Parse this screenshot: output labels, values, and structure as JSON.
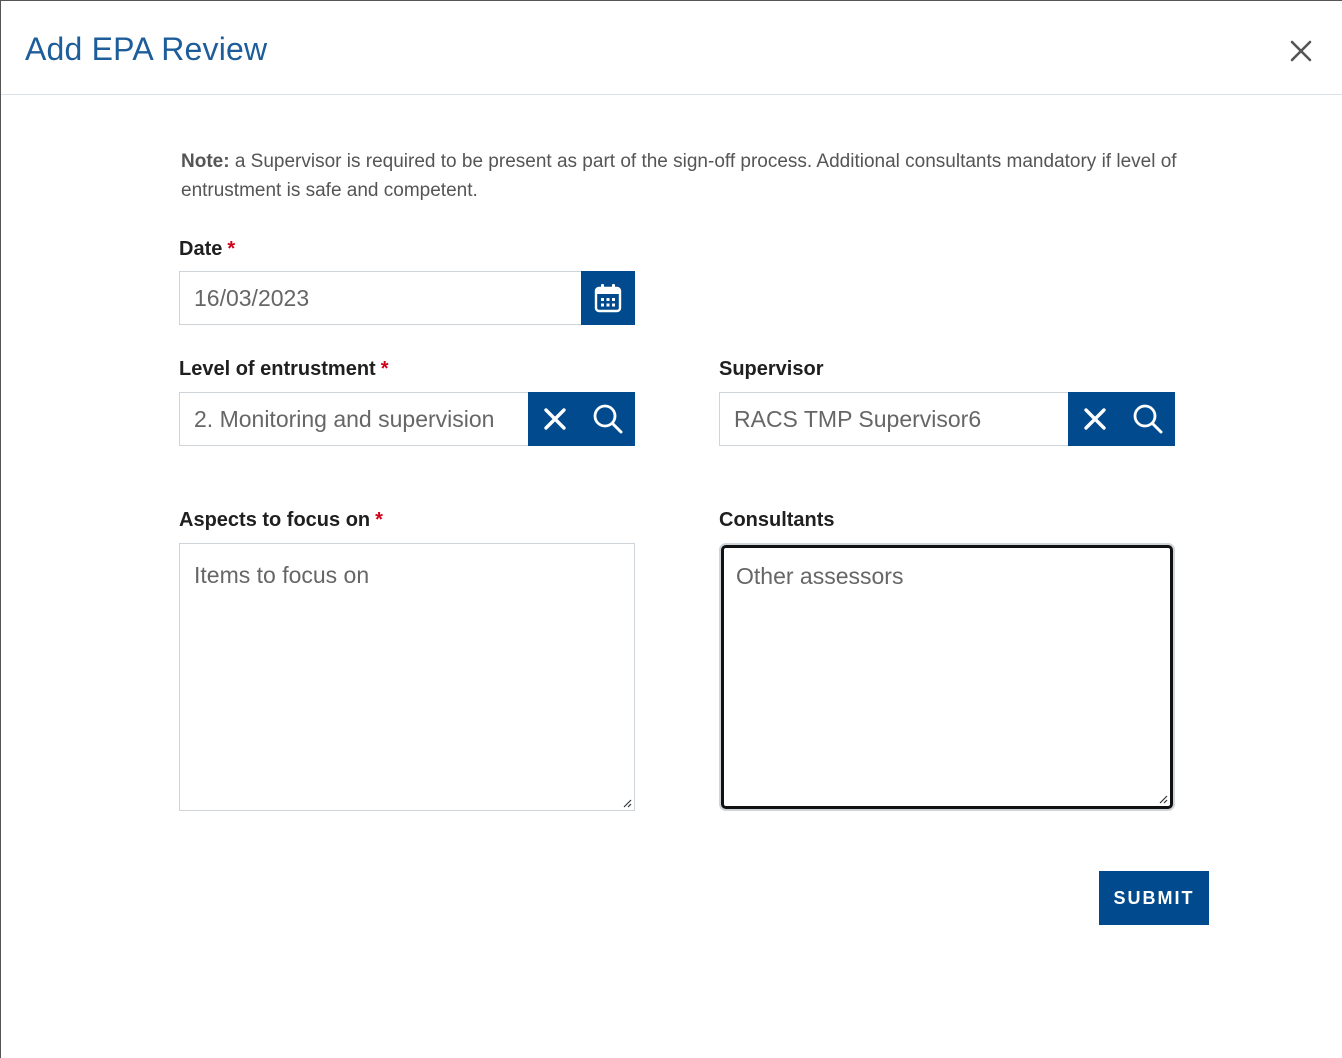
{
  "modal": {
    "title": "Add EPA Review",
    "close_label": "×"
  },
  "note": {
    "bold": "Note:",
    "text": " a Supervisor is required to be present as part of the sign-off process. Additional consultants mandatory if level of entrustment is safe and competent."
  },
  "date": {
    "label": "Date",
    "required_mark": "*",
    "value": "16/03/2023"
  },
  "entrustment": {
    "label": "Level of entrustment",
    "required_mark": "*",
    "value": "2. Monitoring and supervision"
  },
  "supervisor": {
    "label": "Supervisor",
    "value": "RACS TMP Supervisor6"
  },
  "aspects": {
    "label": "Aspects to focus on",
    "required_mark": "*",
    "placeholder": "Items to focus on"
  },
  "consultants": {
    "label": "Consultants",
    "placeholder": "Other assessors"
  },
  "submit_label": "SUBMIT",
  "colors": {
    "title": "#1d5d99",
    "button": "#004a8d",
    "required": "#d0021b"
  }
}
